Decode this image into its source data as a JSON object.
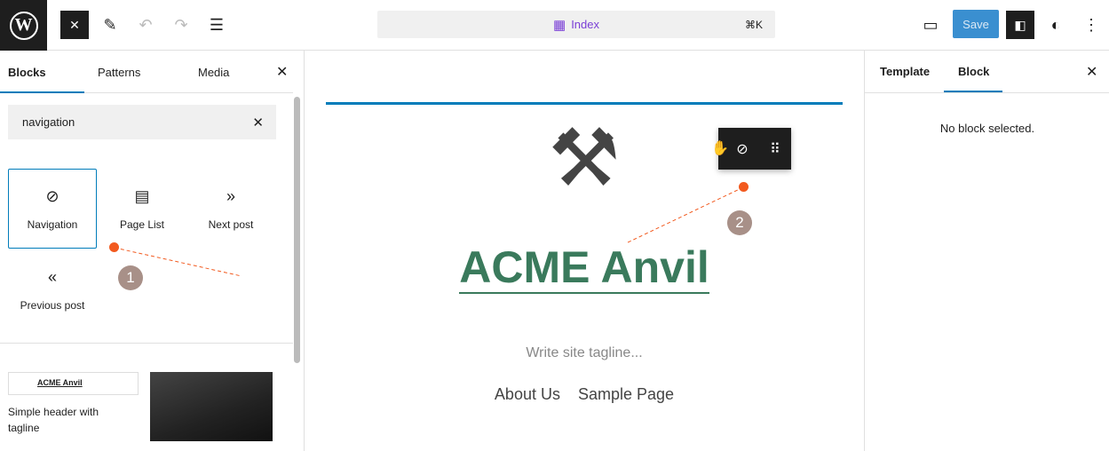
{
  "topbar": {
    "logo": "W",
    "document_title": "Index",
    "shortcut": "⌘K",
    "save_label": "Save",
    "icons": [
      "wordpress-logo",
      "close-icon",
      "pencil-icon",
      "undo-icon",
      "redo-icon",
      "list-view-icon",
      "template-icon",
      "desktop-preview-icon",
      "settings-sidebar-icon",
      "styles-icon",
      "more-options-icon"
    ]
  },
  "inserter": {
    "tabs": [
      "Blocks",
      "Patterns",
      "Media"
    ],
    "search_value": "navigation",
    "blocks": [
      {
        "label": "Navigation",
        "icon": "compass-icon"
      },
      {
        "label": "Page List",
        "icon": "page-list-icon"
      },
      {
        "label": "Next post",
        "icon": "chevron-double-right-icon"
      },
      {
        "label": "Previous post",
        "icon": "chevron-double-left-icon"
      }
    ],
    "patterns": [
      {
        "label": "Simple header with tagline",
        "preview_title": "ACME Anvil"
      }
    ]
  },
  "canvas": {
    "site_title": "ACME Anvil",
    "tagline_placeholder": "Write site tagline...",
    "nav_items": [
      "About Us",
      "Sample Page"
    ],
    "accent": "#3a7a5c"
  },
  "settings": {
    "tabs": [
      "Template",
      "Block"
    ],
    "empty_message": "No block selected."
  },
  "annotations": [
    "1",
    "2"
  ],
  "colors": {
    "primary": "#007cba",
    "annotation": "#f25a1f"
  }
}
